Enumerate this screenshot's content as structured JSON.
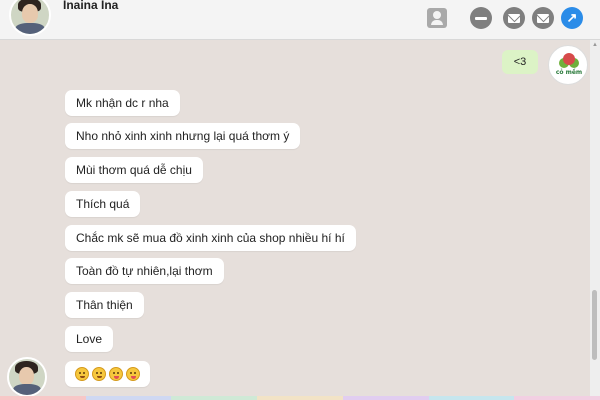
{
  "header": {
    "contact_name": "Inaina Ina",
    "icons": [
      "avatar",
      "contact-card-icon",
      "minus-icon",
      "mail-icon",
      "mail-icon",
      "share-icon"
    ],
    "share_glyph": "↗"
  },
  "conversation": {
    "outgoing": [
      {
        "text": "<3"
      }
    ],
    "incoming": [
      {
        "text": "Mk nhận dc r nha"
      },
      {
        "text": "Nho nhỏ xinh xinh nhưng lại quá thơm ý"
      },
      {
        "text": "Mùi thơm quá dễ chịu"
      },
      {
        "text": "Thích quá"
      },
      {
        "text": "Chắc mk sẽ mua đồ xinh xinh của shop nhiều hí hí"
      },
      {
        "text": "Toàn đồ tự nhiên,lại thơm"
      },
      {
        "text": "Thân thiện"
      },
      {
        "text": "Love"
      }
    ],
    "emoji_message": [
      "grin-emoji",
      "grin-emoji",
      "tongue-emoji",
      "tongue-emoji"
    ]
  },
  "shop_logo_text": "cỏ mềm",
  "colors": {
    "chat_background": "#e6dfdb",
    "outgoing_bubble": "#dcf3c6",
    "incoming_bubble": "#ffffff",
    "accent": "#2b8ce8",
    "bottom_strip": [
      "#f7c7c7",
      "#cfd8f2",
      "#cfe9d6",
      "#f2e3c6",
      "#e1cdf0",
      "#c6e6ee",
      "#f2cfe2"
    ]
  }
}
